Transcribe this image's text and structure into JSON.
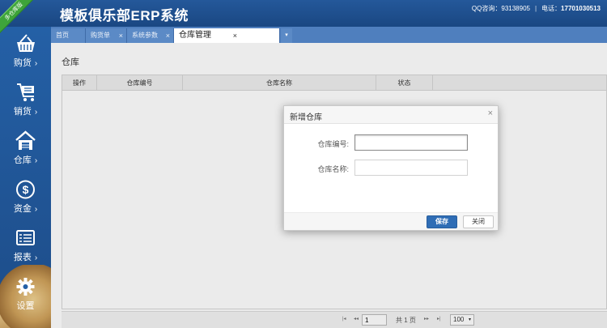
{
  "header": {
    "title": "模板俱乐部ERP系统",
    "qq_label": "QQ咨询：",
    "qq_value": "93138905",
    "phone_label": "电话：",
    "phone_value": "17701030513"
  },
  "ribbon": {
    "text": "多仓库版"
  },
  "sidebar": {
    "items": [
      {
        "label": "购货",
        "icon": "basket-icon"
      },
      {
        "label": "销货",
        "icon": "cart-icon"
      },
      {
        "label": "仓库",
        "icon": "warehouse-icon"
      },
      {
        "label": "资金",
        "icon": "dollar-icon"
      },
      {
        "label": "报表",
        "icon": "report-icon"
      },
      {
        "label": "设置",
        "icon": "gear-icon"
      }
    ],
    "chevron": "›"
  },
  "tabs": [
    {
      "label": "首页",
      "closable": false
    },
    {
      "label": "购货单",
      "closable": true
    },
    {
      "label": "系统参数",
      "closable": true
    },
    {
      "label": "仓库管理",
      "closable": true,
      "active": true
    }
  ],
  "tab_close_glyph": "×",
  "tab_menu_glyph": "▾",
  "page": {
    "title": "仓库",
    "columns": [
      "操作",
      "仓库编号",
      "仓库名称",
      "状态"
    ]
  },
  "pager": {
    "first": "|◂",
    "prev": "◂◂",
    "page_value": "1",
    "total": "共 1 页",
    "next": "▸▸",
    "last": "▸|",
    "page_size": "100",
    "dropdown": "▾"
  },
  "dialog": {
    "title": "新增仓库",
    "close": "×",
    "code_label": "仓库编号:",
    "code_value": "",
    "name_label": "仓库名称:",
    "name_value": "",
    "save_label": "保存",
    "close_label": "关闭"
  },
  "colors": {
    "header_bg": "#1e4f8c",
    "tab_bar_bg": "#4f7fbe",
    "primary_button": "#2f6db5",
    "ribbon": "#3ea43a"
  }
}
